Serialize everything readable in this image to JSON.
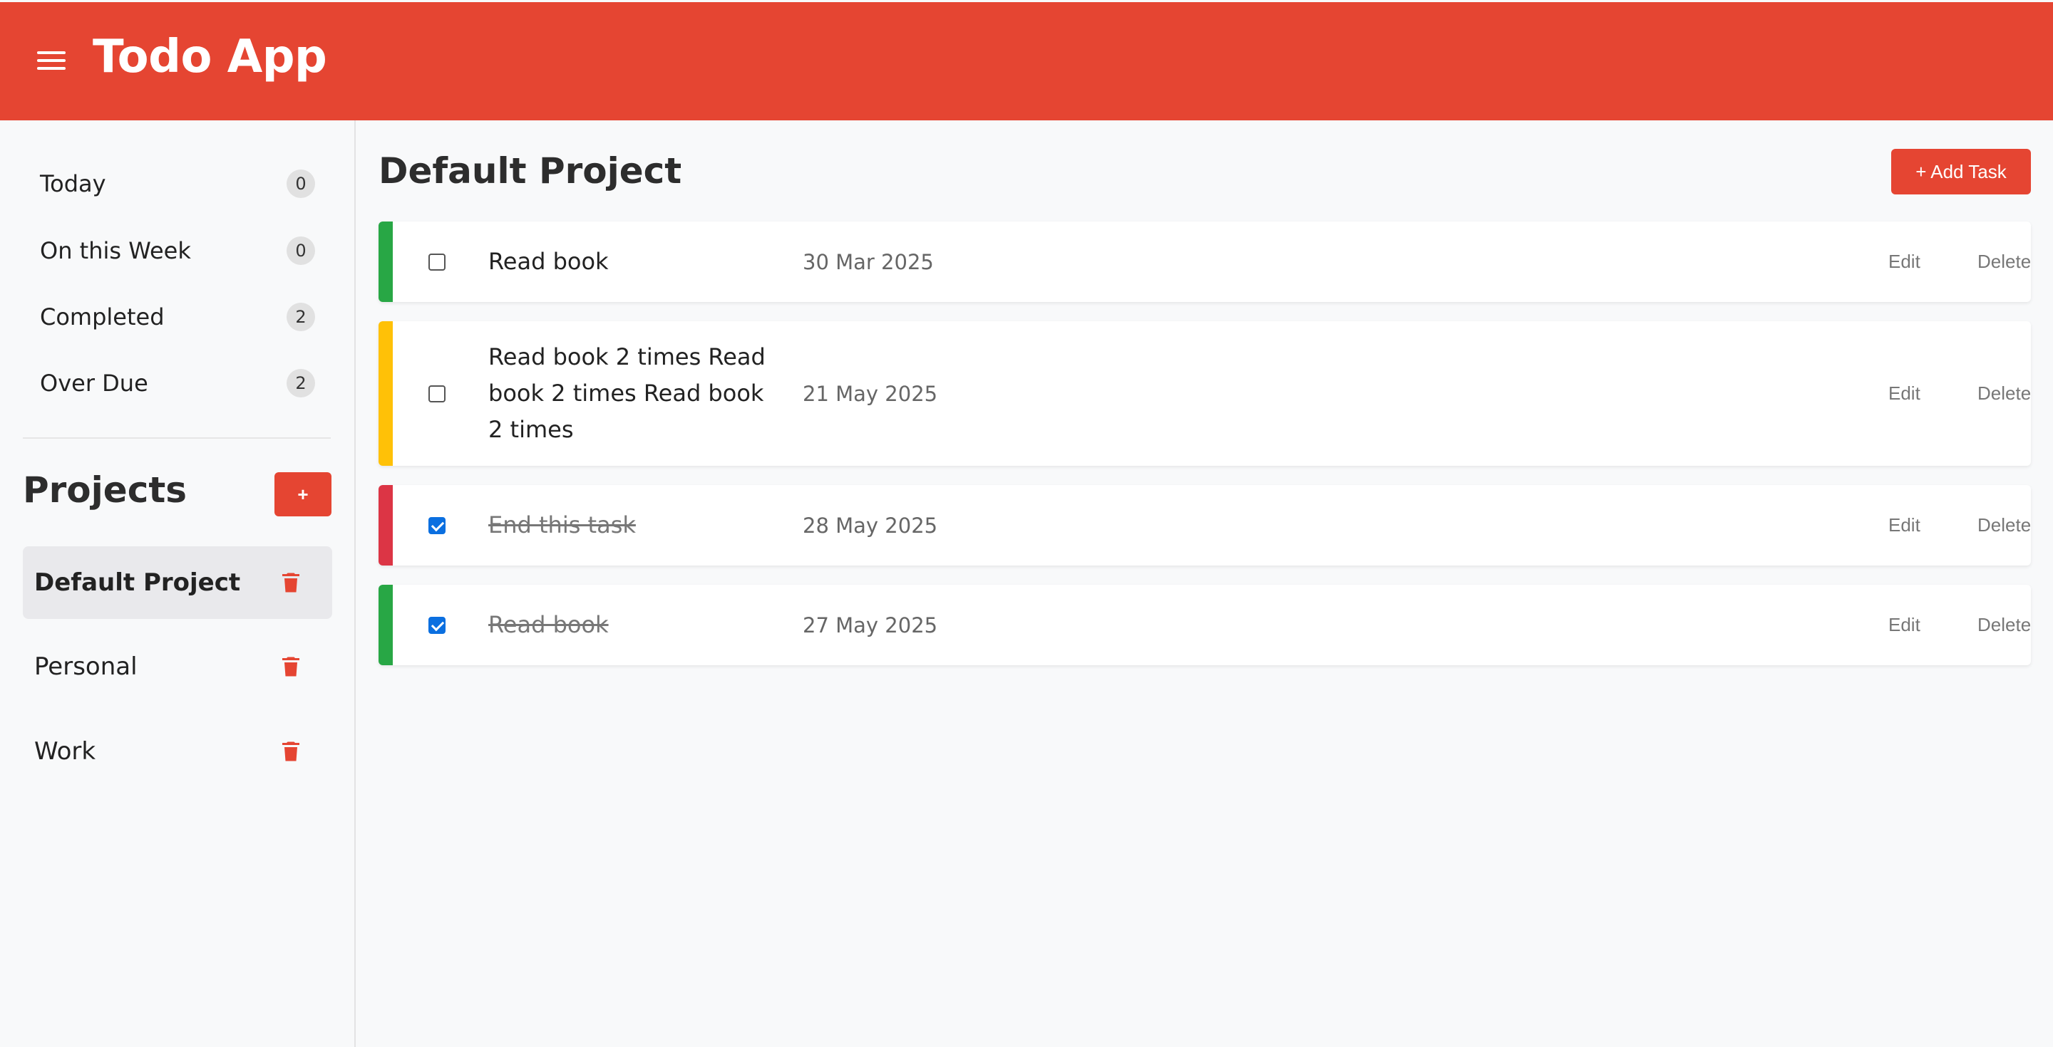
{
  "app": {
    "title": "Todo App",
    "accent": "#e54532"
  },
  "sidebar": {
    "filters": [
      {
        "label": "Today",
        "count": "0"
      },
      {
        "label": "On this Week",
        "count": "0"
      },
      {
        "label": "Completed",
        "count": "2"
      },
      {
        "label": "Over Due",
        "count": "2"
      }
    ],
    "projects_title": "Projects",
    "add_project_label": "+",
    "projects": [
      {
        "name": "Default Project",
        "active": true
      },
      {
        "name": "Personal",
        "active": false
      },
      {
        "name": "Work",
        "active": false
      }
    ]
  },
  "main": {
    "title": "Default Project",
    "add_task_label": "+ Add Task",
    "tasks": [
      {
        "title": "Read book",
        "date": "30 Mar 2025",
        "completed": false,
        "priority_color": "#28a745",
        "edit_label": "Edit",
        "delete_label": "Delete"
      },
      {
        "title": "Read book 2 times Read book 2 times Read book 2 times",
        "date": "21 May 2025",
        "completed": false,
        "priority_color": "#ffc107",
        "edit_label": "Edit",
        "delete_label": "Delete"
      },
      {
        "title": "End this task",
        "date": "28 May 2025",
        "completed": true,
        "priority_color": "#dc3545",
        "edit_label": "Edit",
        "delete_label": "Delete"
      },
      {
        "title": "Read book",
        "date": "27 May 2025",
        "completed": true,
        "priority_color": "#28a745",
        "edit_label": "Edit",
        "delete_label": "Delete"
      }
    ]
  }
}
